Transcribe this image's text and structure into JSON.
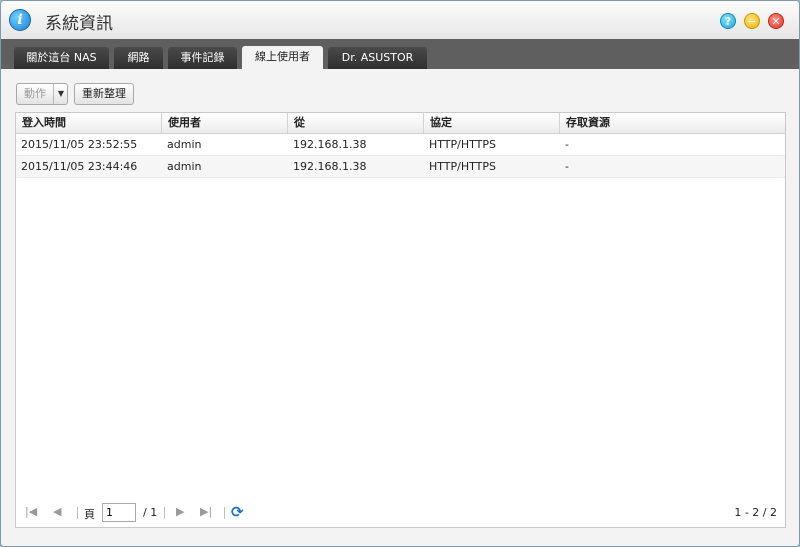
{
  "window": {
    "title": "系統資訊",
    "app_icon": "i",
    "help_icon": "?",
    "min_icon": "−",
    "close_icon": "✕"
  },
  "tabs": [
    {
      "label": "關於這台 NAS"
    },
    {
      "label": "網路"
    },
    {
      "label": "事件記錄"
    },
    {
      "label": "線上使用者",
      "active": true
    },
    {
      "label": "Dr. ASUSTOR"
    }
  ],
  "toolbar": {
    "action_label": "動作",
    "refresh_label": "重新整理"
  },
  "table": {
    "columns": [
      "登入時間",
      "使用者",
      "從",
      "協定",
      "存取資源"
    ],
    "rows": [
      [
        "2015/11/05 23:52:55",
        "admin",
        "192.168.1.38",
        "HTTP/HTTPS",
        "-"
      ],
      [
        "2015/11/05 23:44:46",
        "admin",
        "192.168.1.38",
        "HTTP/HTTPS",
        "-"
      ]
    ]
  },
  "pager": {
    "page_label": "頁",
    "page_value": "1",
    "total_pages": "/ 1",
    "count": "1 - 2 / 2"
  },
  "colors": {
    "tabbar": "#5f5f5f",
    "refresh_icon": "#1a73d1"
  }
}
